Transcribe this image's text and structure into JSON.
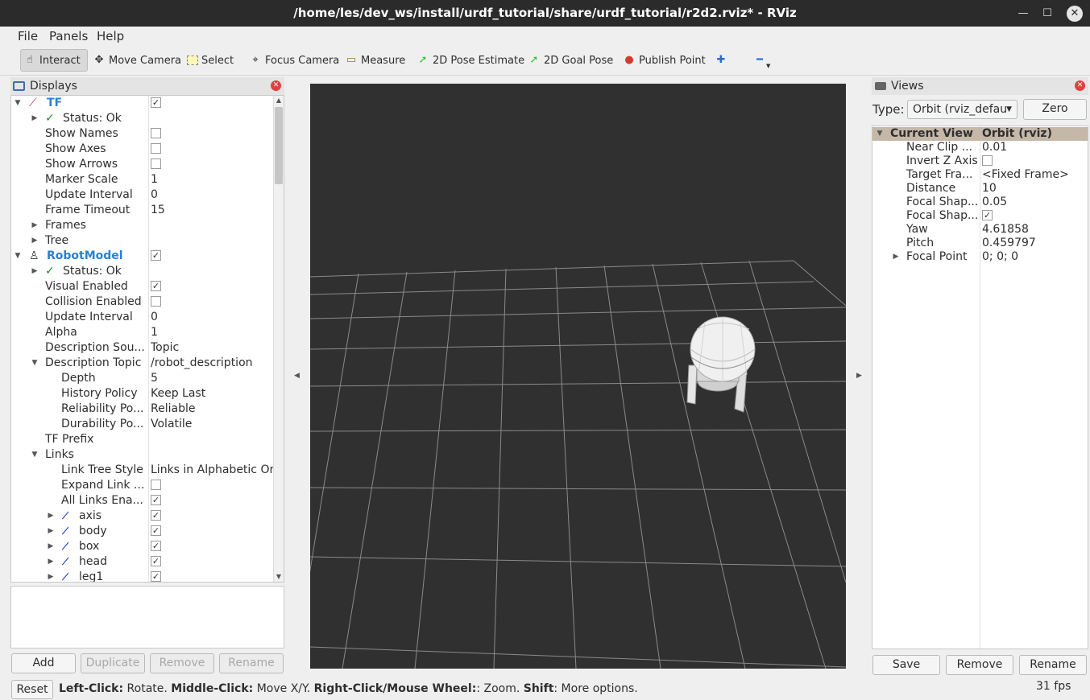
{
  "window": {
    "title": "/home/les/dev_ws/install/urdf_tutorial/share/urdf_tutorial/r2d2.rviz* - RViz",
    "min": "—",
    "max": "☐",
    "close": "✕"
  },
  "menu": {
    "file": "File",
    "panels": "Panels",
    "help": "Help"
  },
  "toolbar": {
    "interact": "Interact",
    "move_camera": "Move Camera",
    "select": "Select",
    "focus_camera": "Focus Camera",
    "measure": "Measure",
    "pose_estimate": "2D Pose Estimate",
    "goal_pose": "2D Goal Pose",
    "publish_point": "Publish Point"
  },
  "displays": {
    "title": "Displays",
    "rows": [
      {
        "label": "TF",
        "value": "",
        "check": "✓"
      },
      {
        "label": "Status: Ok"
      },
      {
        "label": "Show Names",
        "check": ""
      },
      {
        "label": "Show Axes",
        "check": ""
      },
      {
        "label": "Show Arrows",
        "check": ""
      },
      {
        "label": "Marker Scale",
        "value": "1"
      },
      {
        "label": "Update Interval",
        "value": "0"
      },
      {
        "label": "Frame Timeout",
        "value": "15"
      },
      {
        "label": "Frames"
      },
      {
        "label": "Tree"
      },
      {
        "label": "RobotModel",
        "check": "✓"
      },
      {
        "label": "Status: Ok"
      },
      {
        "label": "Visual Enabled",
        "check": "✓"
      },
      {
        "label": "Collision Enabled",
        "check": ""
      },
      {
        "label": "Update Interval",
        "value": "0"
      },
      {
        "label": "Alpha",
        "value": "1"
      },
      {
        "label": "Description Sou...",
        "value": "Topic"
      },
      {
        "label": "Description Topic",
        "value": "/robot_description"
      },
      {
        "label": "Depth",
        "value": "5"
      },
      {
        "label": "History Policy",
        "value": "Keep Last"
      },
      {
        "label": "Reliability Po...",
        "value": "Reliable"
      },
      {
        "label": "Durability Po...",
        "value": "Volatile"
      },
      {
        "label": "TF Prefix",
        "value": ""
      },
      {
        "label": "Links"
      },
      {
        "label": "Link Tree Style",
        "value": "Links in Alphabetic Or..."
      },
      {
        "label": "Expand Link ...",
        "check": ""
      },
      {
        "label": "All Links Ena...",
        "check": "✓"
      },
      {
        "label": "axis",
        "check": "✓"
      },
      {
        "label": "body",
        "check": "✓"
      },
      {
        "label": "box",
        "check": "✓"
      },
      {
        "label": "head",
        "check": "✓"
      },
      {
        "label": "leg1",
        "check": "✓"
      }
    ],
    "buttons": {
      "add": "Add",
      "duplicate": "Duplicate",
      "remove": "Remove",
      "rename": "Rename"
    }
  },
  "views": {
    "title": "Views",
    "type_label": "Type:",
    "type_value": "Orbit (rviz_defau",
    "zero": "Zero",
    "header": {
      "label": "Current View",
      "value": "Orbit (rviz)"
    },
    "rows": [
      {
        "label": "Near Clip ...",
        "value": "0.01"
      },
      {
        "label": "Invert Z Axis",
        "value": "",
        "check": ""
      },
      {
        "label": "Target Fra...",
        "value": "<Fixed Frame>"
      },
      {
        "label": "Distance",
        "value": "10"
      },
      {
        "label": "Focal Shap...",
        "value": "0.05"
      },
      {
        "label": "Focal Shap...",
        "value": "",
        "check": "✓"
      },
      {
        "label": "Yaw",
        "value": "4.61858"
      },
      {
        "label": "Pitch",
        "value": "0.459797"
      },
      {
        "label": "Focal Point",
        "value": "0; 0; 0"
      }
    ],
    "buttons": {
      "save": "Save",
      "remove": "Remove",
      "rename": "Rename"
    }
  },
  "status": {
    "reset": "Reset",
    "b1": "Left-Click:",
    "t1": " Rotate. ",
    "b2": "Middle-Click:",
    "t2": " Move X/Y. ",
    "b3": "Right-Click/Mouse Wheel:",
    "t3": ": Zoom. ",
    "b4": "Shift",
    "t4": ": More options.",
    "fps": "31 fps"
  }
}
